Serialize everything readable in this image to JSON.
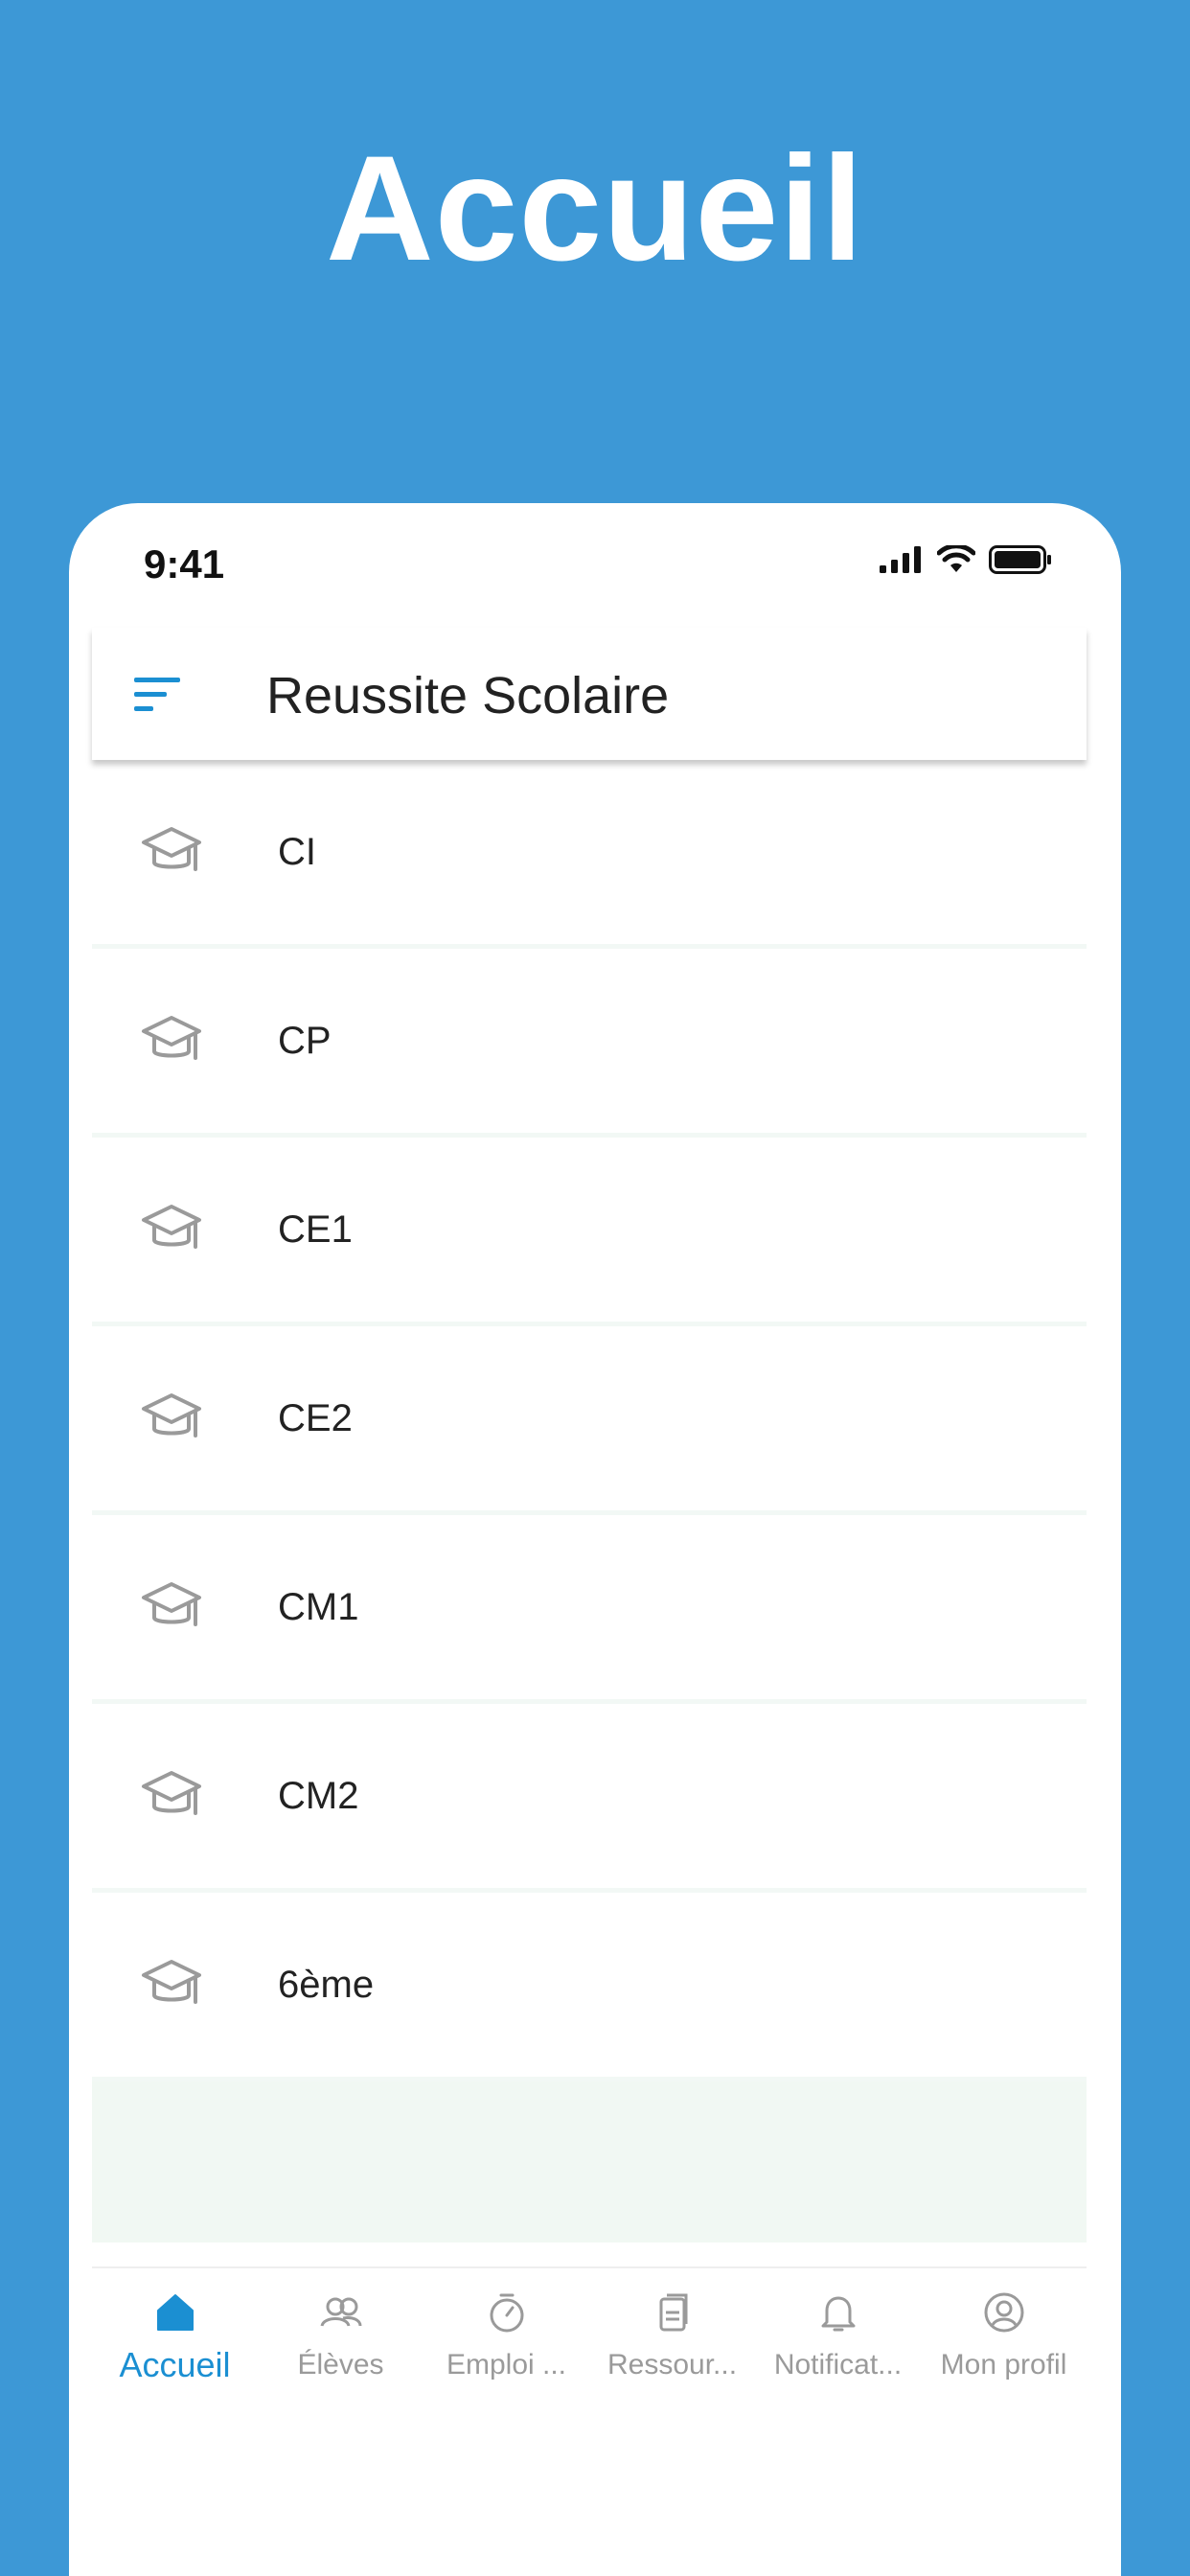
{
  "hero": {
    "title": "Accueil"
  },
  "status_bar": {
    "time": "9:41"
  },
  "app_bar": {
    "title": "Reussite Scolaire",
    "menu_icon": "sort-menu-icon"
  },
  "levels": [
    {
      "label": "CI",
      "icon": "graduation-cap-icon"
    },
    {
      "label": "CP",
      "icon": "graduation-cap-icon"
    },
    {
      "label": "CE1",
      "icon": "graduation-cap-icon"
    },
    {
      "label": "CE2",
      "icon": "graduation-cap-icon"
    },
    {
      "label": "CM1",
      "icon": "graduation-cap-icon"
    },
    {
      "label": "CM2",
      "icon": "graduation-cap-icon"
    },
    {
      "label": "6ème",
      "icon": "graduation-cap-icon"
    }
  ],
  "tabs": [
    {
      "label": "Accueil",
      "icon": "home-icon",
      "active": true
    },
    {
      "label": "Élèves",
      "icon": "students-icon",
      "active": false
    },
    {
      "label": "Emploi ...",
      "icon": "timer-icon",
      "active": false
    },
    {
      "label": "Ressour...",
      "icon": "documents-icon",
      "active": false
    },
    {
      "label": "Notificat...",
      "icon": "bell-icon",
      "active": false
    },
    {
      "label": "Mon profil",
      "icon": "profile-icon",
      "active": false
    }
  ],
  "colors": {
    "background": "#3d98d6",
    "accent": "#1b8fd2",
    "icon_gray": "#9a9a9a"
  }
}
